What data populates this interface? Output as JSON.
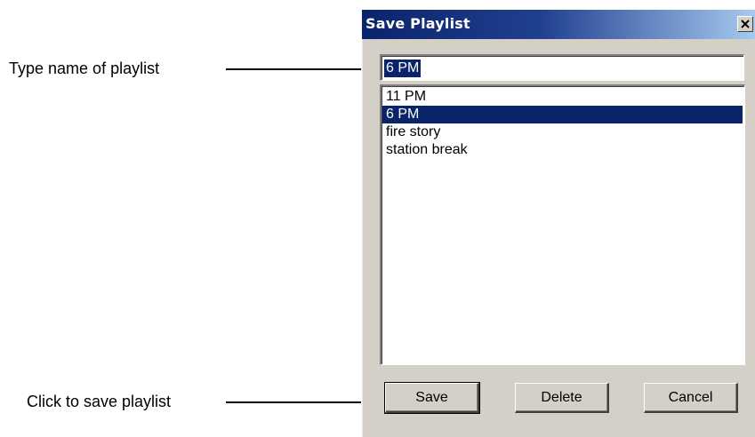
{
  "annotations": {
    "name_callout": "Type name of playlist",
    "save_callout": "Click to save playlist"
  },
  "dialog": {
    "title": "Save Playlist",
    "close_glyph": "×",
    "name_input_value": "6 PM",
    "list_items": [
      "11 PM",
      "6 PM",
      "fire story",
      "station break"
    ],
    "selected_item": "6 PM",
    "buttons": {
      "save": "Save",
      "delete": "Delete",
      "cancel": "Cancel"
    }
  },
  "colors": {
    "title_bar": "#0a246a",
    "selection": "#0a246a",
    "dialog_face": "#d4d0c8"
  }
}
